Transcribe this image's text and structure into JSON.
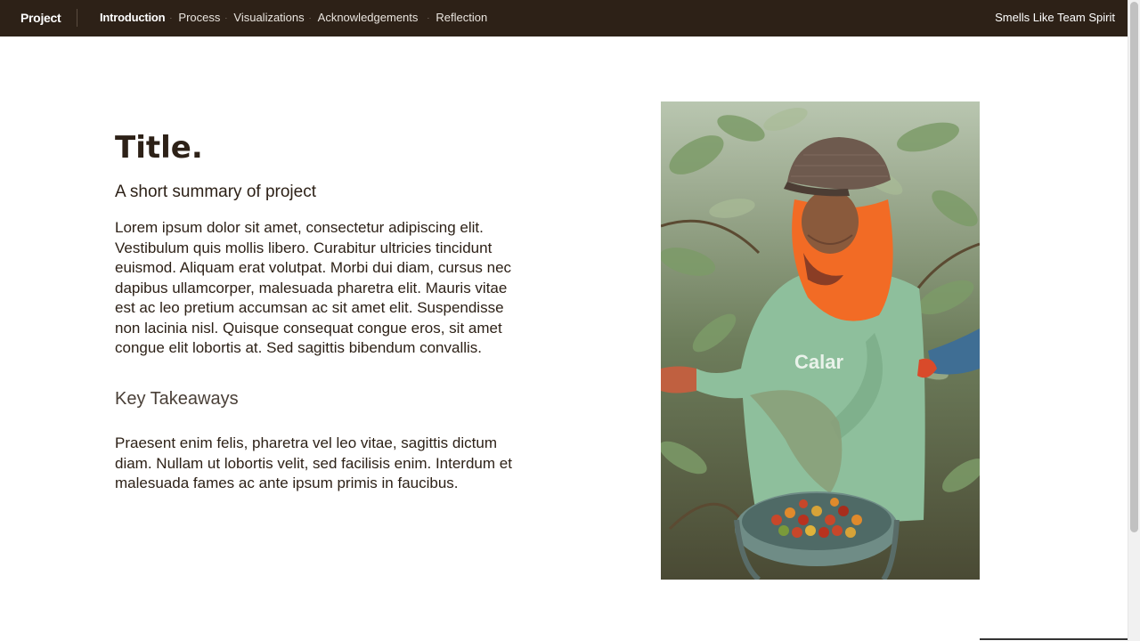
{
  "nav": {
    "brand": "Project",
    "links": [
      "Introduction",
      "Process",
      "Visualizations",
      "Acknowledgements",
      "Reflection"
    ],
    "separator": "·",
    "team_name": "Smells Like Team Spirit"
  },
  "main": {
    "title": "Title.",
    "summary": "A short summary of project",
    "body": "Lorem ipsum dolor sit amet, consectetur adipiscing elit. Vestibulum quis mollis libero. Curabitur ultricies tincidunt euismod. Aliquam erat volutpat. Morbi dui diam, cursus nec dapibus ullamcorper, malesuada pharetra elit. Mauris vitae est ac leo pretium accumsan ac sit amet elit. Suspendisse non lacinia nisl. Quisque consequat congue eros, sit amet congue elit lobortis at. Sed sagittis bibendum convallis.",
    "takeaways_heading": "Key Takeaways",
    "takeaways_body": "Praesent enim felis, pharetra vel leo vitae, sagittis dictum diam. Nullam ut lobortis velit, sed facilisis enim. Interdum et malesuada fames ac ante ipsum primis in faucibus."
  },
  "image": {
    "shirt_text": "Calar"
  },
  "colors": {
    "nav_bg": "#2d2117",
    "text": "#2d2117",
    "leaf_green": "#6f8f5a",
    "shirt": "#8ebf9c",
    "scarf": "#f26b25",
    "cherries": "#c8472a"
  }
}
